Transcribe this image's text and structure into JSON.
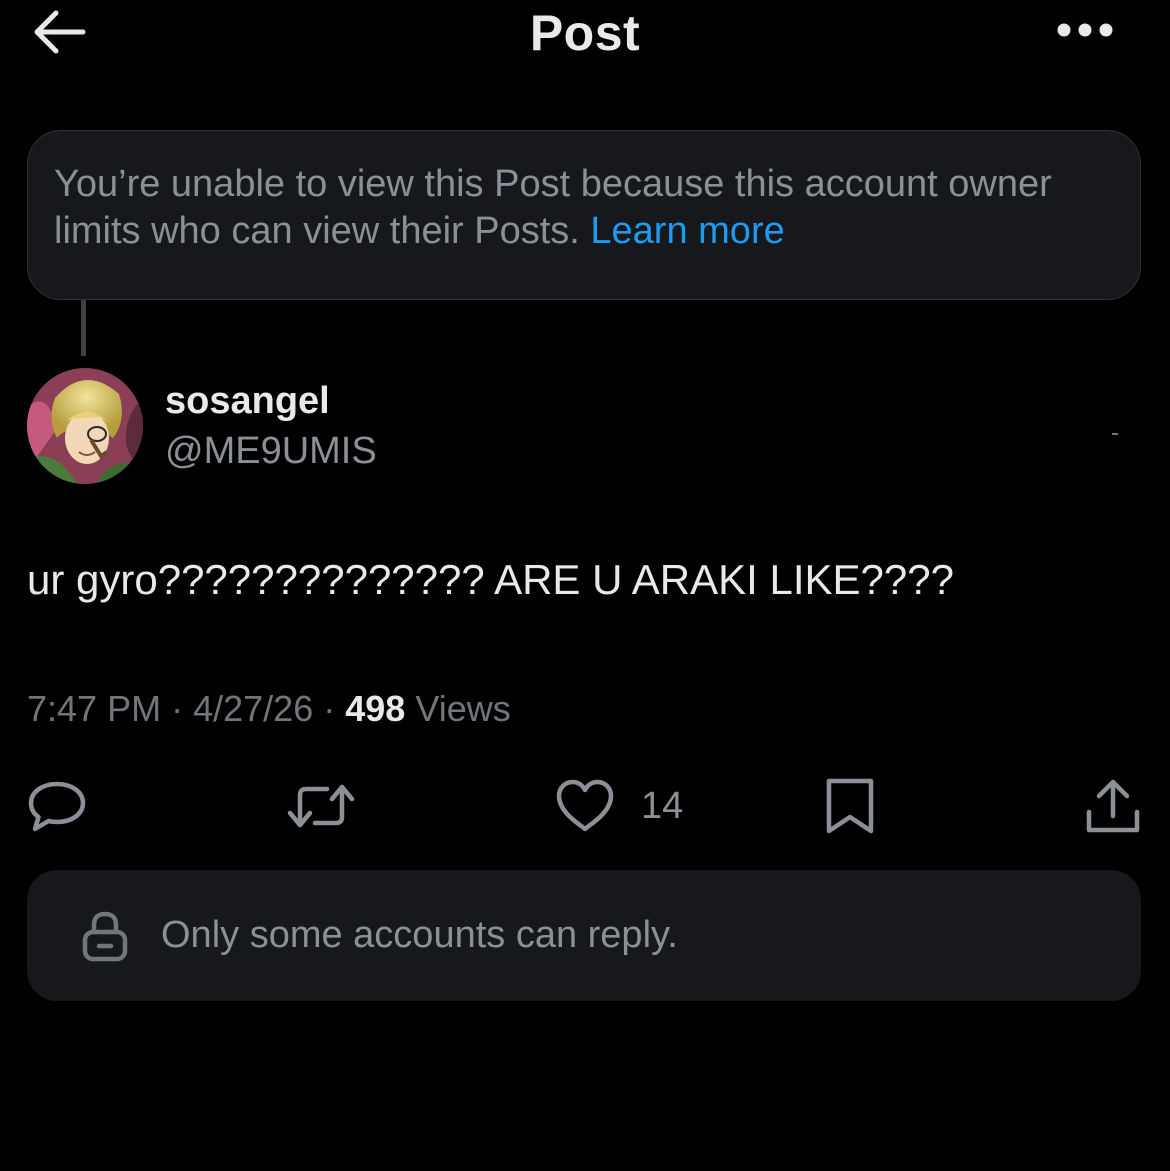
{
  "header": {
    "title": "Post"
  },
  "notice": {
    "text": "You’re unable to view this Post because this account owner limits who can view their Posts.",
    "link": "Learn more"
  },
  "author": {
    "display_name": "sosangel",
    "handle": "@ME9UMIS"
  },
  "post": {
    "text": "ur gyro?????????????? ARE U ARAKI LIKE????",
    "time": "7:47 PM",
    "date": "4/27/26",
    "views_count": "498",
    "views_label": "Views",
    "separator": "·"
  },
  "actions": {
    "like_count": "14"
  },
  "reply_restriction": {
    "text": "Only some accounts can reply."
  },
  "colors": {
    "background": "#000000",
    "card": "#16181c",
    "border": "#2f3336",
    "primary_text": "#e7e9ea",
    "secondary_text": "#71767b",
    "link": "#1d9bf0"
  },
  "icons": [
    "back-arrow-icon",
    "more-icon",
    "reply-icon",
    "repost-icon",
    "like-icon",
    "bookmark-icon",
    "share-icon",
    "lock-icon"
  ]
}
